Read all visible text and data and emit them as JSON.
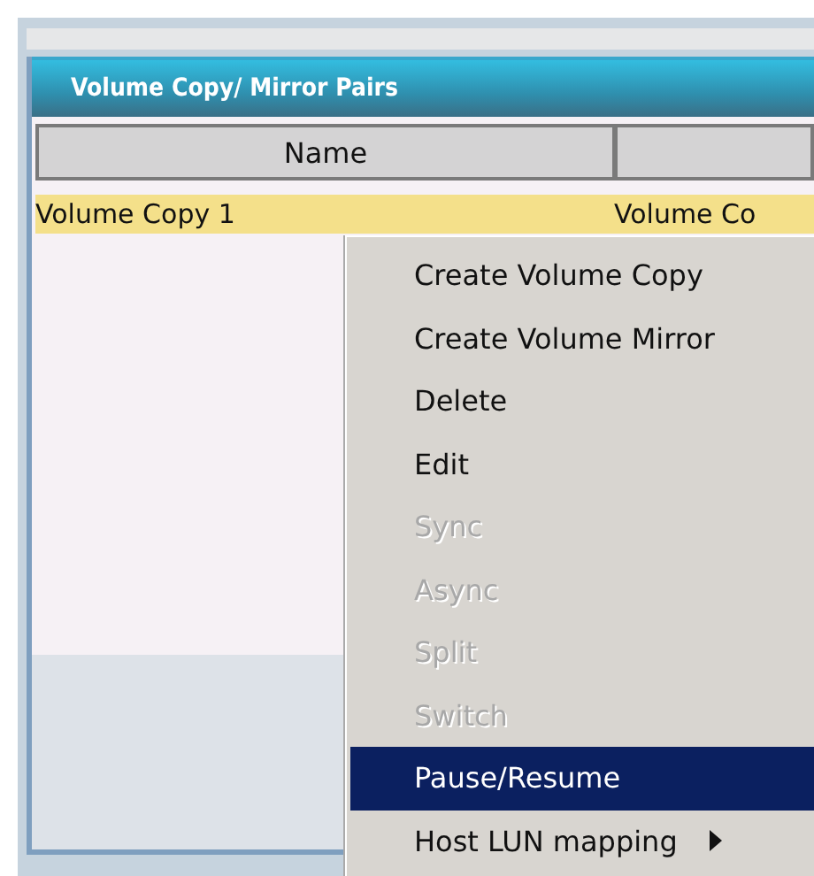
{
  "panel": {
    "title": "Volume Copy/ Mirror Pairs"
  },
  "table": {
    "columns": [
      "Name"
    ],
    "rows": [
      {
        "cells": [
          "Volume Copy 1",
          "Volume Co"
        ],
        "selected": true
      }
    ]
  },
  "context_menu": {
    "items": [
      {
        "label": "Create Volume Copy",
        "disabled": false,
        "selected": false
      },
      {
        "label": "Create Volume Mirror",
        "disabled": false,
        "selected": false
      },
      {
        "label": "Delete",
        "disabled": false,
        "selected": false
      },
      {
        "label": "Edit",
        "disabled": false,
        "selected": false
      },
      {
        "label": "Sync",
        "disabled": true,
        "selected": false
      },
      {
        "label": "Async",
        "disabled": true,
        "selected": false
      },
      {
        "label": "Split",
        "disabled": true,
        "selected": false
      },
      {
        "label": "Switch",
        "disabled": true,
        "selected": false
      },
      {
        "label": "Pause/Resume",
        "disabled": false,
        "selected": true
      },
      {
        "label": "Host LUN mapping",
        "disabled": false,
        "selected": false,
        "submenu": true
      }
    ]
  }
}
